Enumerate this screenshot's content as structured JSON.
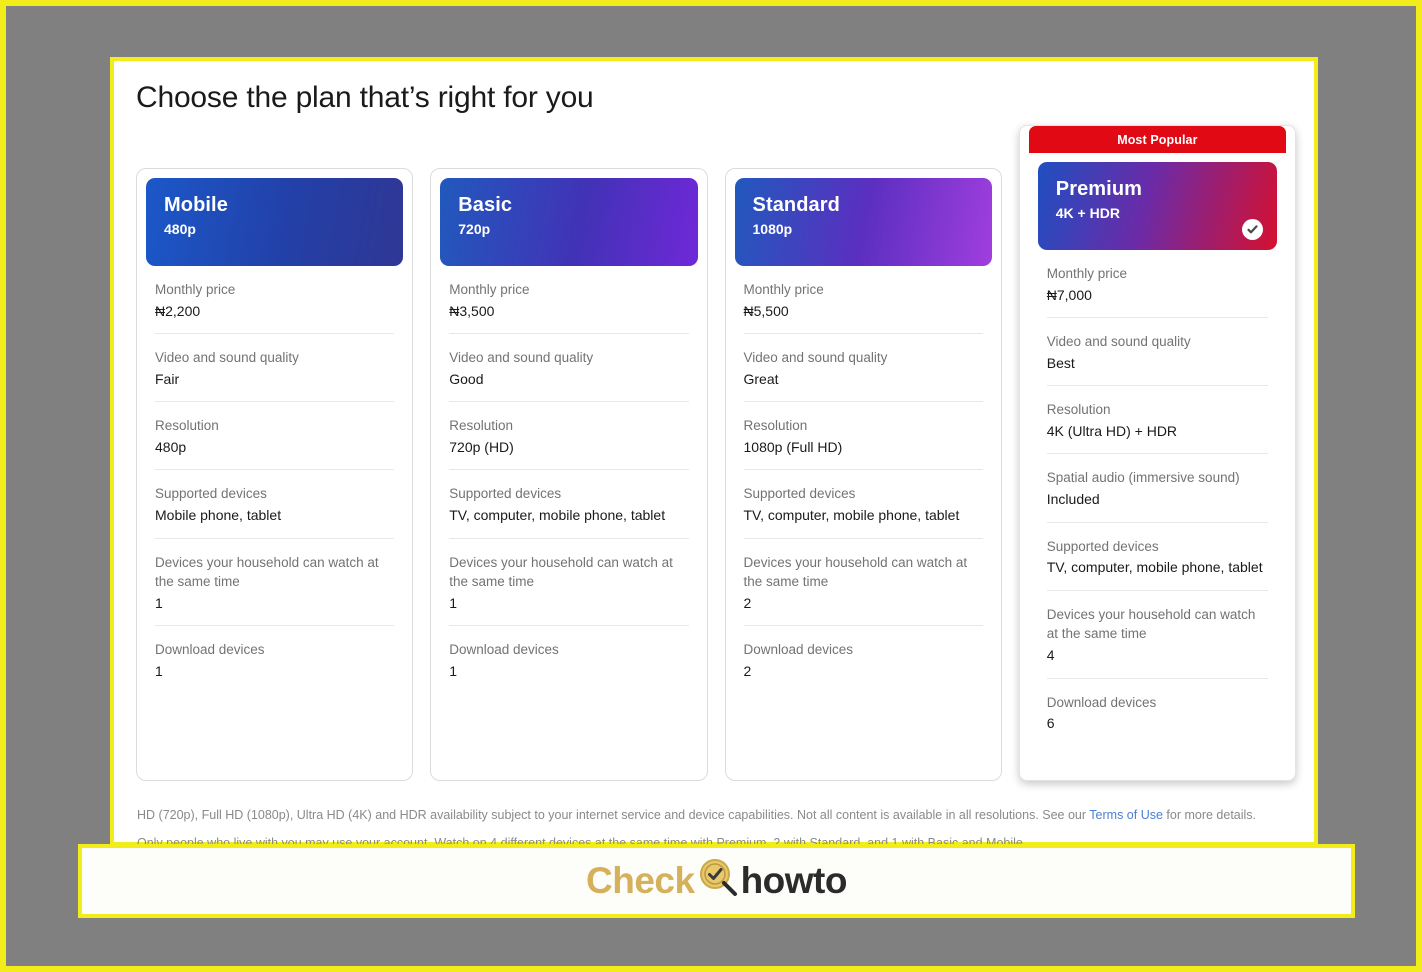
{
  "page": {
    "title": "Choose the plan that’s right for you"
  },
  "badges": {
    "most_popular": "Most Popular",
    "selected_icon": "check-circle-icon"
  },
  "plans": [
    {
      "name": "Mobile",
      "resolution_tag": "480p",
      "featured": false,
      "selected": false,
      "features": [
        {
          "label": "Monthly price",
          "value": "₦2,200"
        },
        {
          "label": "Video and sound quality",
          "value": "Fair"
        },
        {
          "label": "Resolution",
          "value": "480p"
        },
        {
          "label": "Supported devices",
          "value": "Mobile phone, tablet"
        },
        {
          "label": "Devices your household can watch at the same time",
          "value": "1"
        },
        {
          "label": "Download devices",
          "value": "1"
        }
      ]
    },
    {
      "name": "Basic",
      "resolution_tag": "720p",
      "featured": false,
      "selected": false,
      "features": [
        {
          "label": "Monthly price",
          "value": "₦3,500"
        },
        {
          "label": "Video and sound quality",
          "value": "Good"
        },
        {
          "label": "Resolution",
          "value": "720p (HD)"
        },
        {
          "label": "Supported devices",
          "value": "TV, computer, mobile phone, tablet"
        },
        {
          "label": "Devices your household can watch at the same time",
          "value": "1"
        },
        {
          "label": "Download devices",
          "value": "1"
        }
      ]
    },
    {
      "name": "Standard",
      "resolution_tag": "1080p",
      "featured": false,
      "selected": false,
      "features": [
        {
          "label": "Monthly price",
          "value": "₦5,500"
        },
        {
          "label": "Video and sound quality",
          "value": "Great"
        },
        {
          "label": "Resolution",
          "value": "1080p (Full HD)"
        },
        {
          "label": "Supported devices",
          "value": "TV, computer, mobile phone, tablet"
        },
        {
          "label": "Devices your household can watch at the same time",
          "value": "2"
        },
        {
          "label": "Download devices",
          "value": "2"
        }
      ]
    },
    {
      "name": "Premium",
      "resolution_tag": "4K + HDR",
      "featured": true,
      "selected": true,
      "features": [
        {
          "label": "Monthly price",
          "value": "₦7,000"
        },
        {
          "label": "Video and sound quality",
          "value": "Best"
        },
        {
          "label": "Resolution",
          "value": "4K (Ultra HD) + HDR"
        },
        {
          "label": "Spatial audio (immersive sound)",
          "value": "Included"
        },
        {
          "label": "Supported devices",
          "value": "TV, computer, mobile phone, tablet"
        },
        {
          "label": "Devices your household can watch at the same time",
          "value": "4"
        },
        {
          "label": "Download devices",
          "value": "6"
        }
      ]
    }
  ],
  "notes": {
    "line1_before_link": "HD (720p), Full HD (1080p), Ultra HD (4K) and HDR availability subject to your internet service and device capabilities. Not all content is available in all resolutions. See our ",
    "line1_link": "Terms of Use",
    "line1_after_link": " for more details.",
    "line2": "Only people who live with you may use your account. Watch on 4 different devices at the same time with Premium, 2 with Standard, and 1 with Basic and Mobile."
  },
  "watermark": {
    "text_left": "Check",
    "text_right": "howto",
    "icon": "magnifier-check-icon"
  },
  "colors": {
    "frame_yellow": "#f2ec1a",
    "background_gray": "#808080",
    "banner_red": "#e00914",
    "link_blue": "#4a7fd4",
    "logo_gold": "#d4b15a"
  }
}
